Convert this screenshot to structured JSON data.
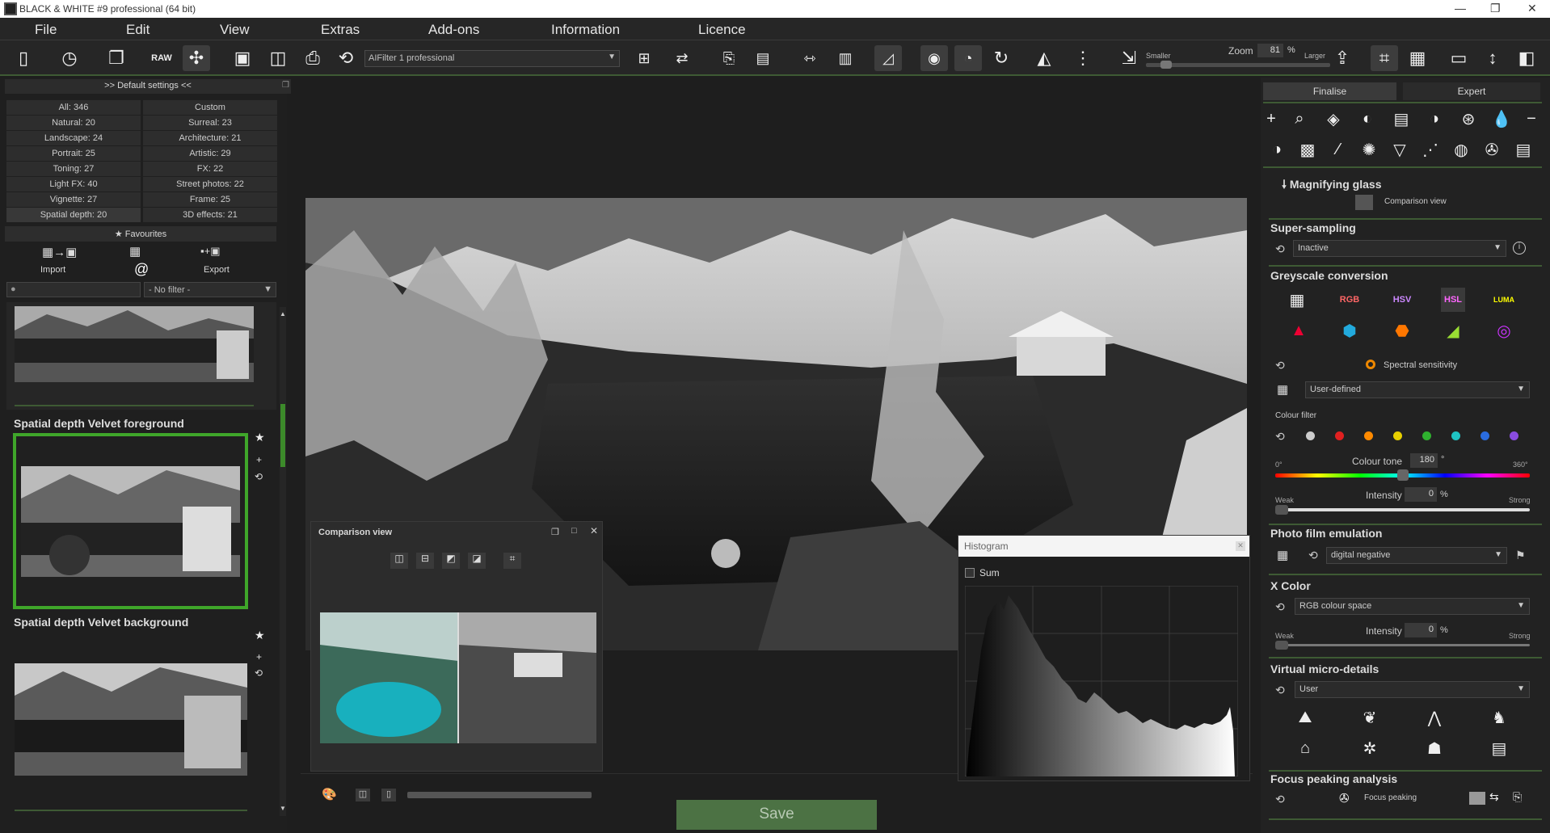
{
  "window": {
    "title": "BLACK & WHITE #9 professional (64 bit)"
  },
  "menu": [
    "File",
    "Edit",
    "View",
    "Extras",
    "Add-ons",
    "Information",
    "Licence"
  ],
  "toolbar": {
    "filter_select": "AIFilter 1 professional",
    "zoom_label": "Zoom",
    "zoom_value": "81",
    "zoom_unit": "%",
    "smaller": "Smaller",
    "larger": "Larger",
    "zoom_level": 0.08
  },
  "left": {
    "header": ">> Default settings <<",
    "categories": [
      [
        "All: 346",
        "Custom"
      ],
      [
        "Natural: 20",
        "Surreal: 23"
      ],
      [
        "Landscape: 24",
        "Architecture: 21"
      ],
      [
        "Portrait: 25",
        "Artistic: 29"
      ],
      [
        "Toning: 27",
        "FX: 22"
      ],
      [
        "Light FX: 40",
        "Street photos: 22"
      ],
      [
        "Vignette: 27",
        "Frame: 25"
      ],
      [
        "Spatial depth: 20",
        "3D effects: 21"
      ]
    ],
    "favourites": "Favourites",
    "import": "Import",
    "export": "Export",
    "at": "@",
    "filter_placeholder": "- No filter -",
    "presets": [
      "Spatial depth Velvet foreground",
      "Spatial depth Velvet background"
    ]
  },
  "compare": {
    "title": "Comparison view"
  },
  "histogram": {
    "title": "Histogram",
    "sum": "Sum"
  },
  "save": "Save",
  "right": {
    "tabs": [
      "Finalise",
      "Expert"
    ],
    "magnifier": {
      "title": "Magnifying glass",
      "comparison": "Comparison view"
    },
    "supersampling": {
      "title": "Super-sampling",
      "value": "Inactive"
    },
    "greyscale": {
      "title": "Greyscale conversion",
      "spectral": "Spectral sensitivity",
      "mode": "User-defined",
      "colour_filter": "Colour filter",
      "tone_label": "Colour tone",
      "tone_value": "180",
      "tone_unit": "°",
      "deg0": "0°",
      "deg360": "360°",
      "weak": "Weak",
      "intensity": "Intensity",
      "intensity_value": "0",
      "pct": "%",
      "strong": "Strong"
    },
    "film": {
      "title": "Photo film emulation",
      "value": "digital negative"
    },
    "xcolor": {
      "title": "X Color",
      "value": "RGB colour space",
      "weak": "Weak",
      "intensity": "Intensity",
      "intensity_value": "0",
      "pct": "%",
      "strong": "Strong"
    },
    "micro": {
      "title": "Virtual micro-details",
      "value": "User"
    },
    "focus": {
      "title": "Focus peaking analysis",
      "label": "Focus peaking"
    }
  },
  "colors": {
    "accent": "#3fa62a",
    "filter_dots": [
      "#cccccc",
      "#e02020",
      "#ff8a00",
      "#e8d000",
      "#2fb02f",
      "#1fc4c4",
      "#2a6ce0",
      "#8a4ce0"
    ]
  }
}
